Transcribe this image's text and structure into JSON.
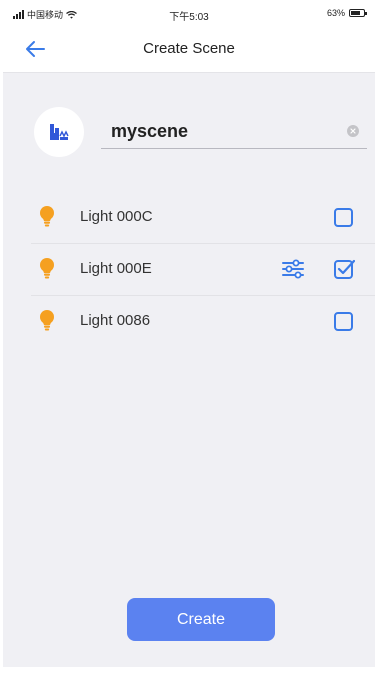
{
  "status_bar": {
    "carrier": "中国移动",
    "time": "下午5:03",
    "battery": "63%"
  },
  "nav": {
    "title": "Create Scene",
    "back_icon": "arrow-left-icon"
  },
  "scene": {
    "icon": "scene-icon",
    "name": "myscene"
  },
  "lights": [
    {
      "label": "Light 000C",
      "checked": false,
      "adjustable": false
    },
    {
      "label": "Light 000E",
      "checked": true,
      "adjustable": true
    },
    {
      "label": "Light 0086",
      "checked": false,
      "adjustable": false
    }
  ],
  "actions": {
    "create_label": "Create"
  },
  "colors": {
    "accent": "#3a7be8",
    "button": "#5b82f0",
    "bulb": "#f5a020",
    "background": "#f0f0f4"
  }
}
